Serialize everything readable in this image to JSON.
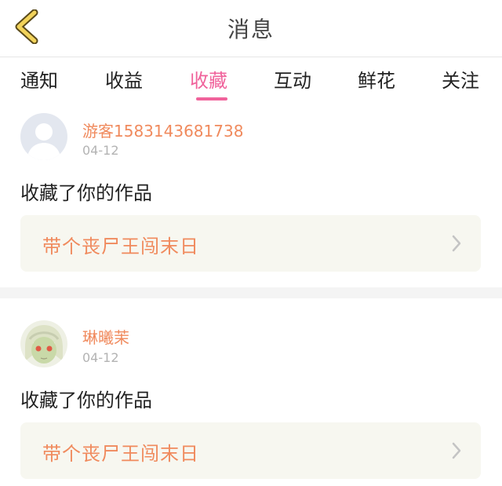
{
  "header": {
    "title": "消息",
    "back_icon": "chevron-left-icon",
    "back_color": "#f2d35b"
  },
  "tabs": [
    {
      "label": "通知"
    },
    {
      "label": "收益"
    },
    {
      "label": "收藏",
      "active": true
    },
    {
      "label": "互动"
    },
    {
      "label": "鲜花"
    },
    {
      "label": "关注"
    }
  ],
  "messages": [
    {
      "username": "游客1583143681738",
      "date": "04-12",
      "action": "收藏了你的作品",
      "work_title": "带个丧尸王闯末日",
      "avatar": "default-avatar-icon"
    },
    {
      "username": "琳曦茉",
      "date": "04-12",
      "action": "收藏了你的作品",
      "work_title": "带个丧尸王闯末日",
      "avatar": "anime-avatar-icon"
    }
  ],
  "colors": {
    "accent": "#f0629b",
    "username": "#f08a5d",
    "date": "#b3b3b3"
  }
}
